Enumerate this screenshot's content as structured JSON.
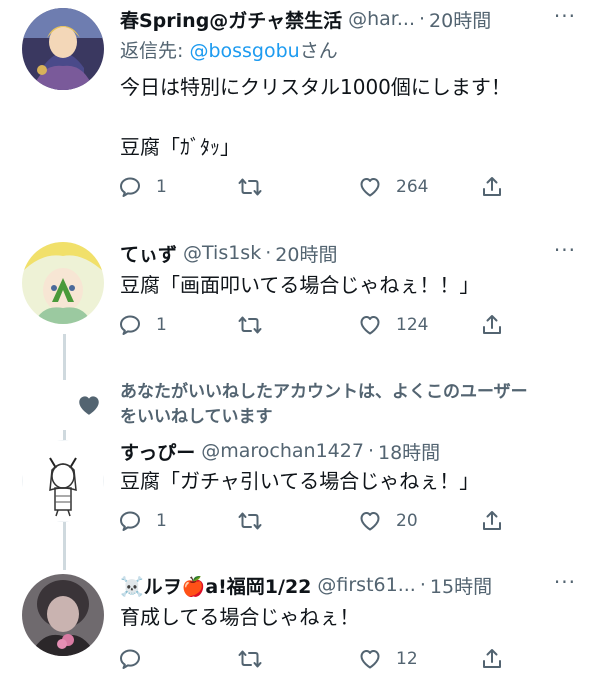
{
  "tweets": [
    {
      "name": "春Spring@ガチャ禁生活",
      "handle": "@har...",
      "dot": "·",
      "time": "20時間",
      "reply_prefix": "返信先: ",
      "reply_mention": "@bossgobu",
      "reply_suffix": "さん",
      "text": "今日は特別にクリスタル1000個にします！\n\n豆腐「ｶﾞﾀｯ」",
      "replies": "1",
      "retweets": "",
      "likes": "264"
    },
    {
      "name": "てぃず",
      "handle": "@Tis1sk",
      "dot": "·",
      "time": "20時間",
      "text": "豆腐「画面叩いてる場合じゃねぇ！！」",
      "replies": "1",
      "retweets": "",
      "likes": "124"
    },
    {
      "name": "すっぴー",
      "handle": "@marochan1427",
      "dot": "·",
      "time": "18時間",
      "text": "豆腐「ガチャ引いてる場合じゃねぇ！」",
      "replies": "1",
      "retweets": "",
      "likes": "20"
    },
    {
      "name": "☠️ルヲ🍎a!福岡1/22",
      "handle": "@first61...",
      "dot": "·",
      "time": "15時間",
      "text": "育成してる場合じゃねぇ！",
      "replies": "",
      "retweets": "",
      "likes": "12"
    }
  ],
  "social_context": "あなたがいいねしたアカウントは、よくこのユーザー\nをいいねしています",
  "more_label": "···",
  "icons": [
    "reply-icon",
    "retweet-icon",
    "like-icon",
    "share-icon",
    "more-icon",
    "heart-icon"
  ],
  "colors": {
    "text": "#0f1419",
    "secondary": "#536471",
    "link": "#1d9bf0",
    "thread_line": "#cfd9de"
  }
}
